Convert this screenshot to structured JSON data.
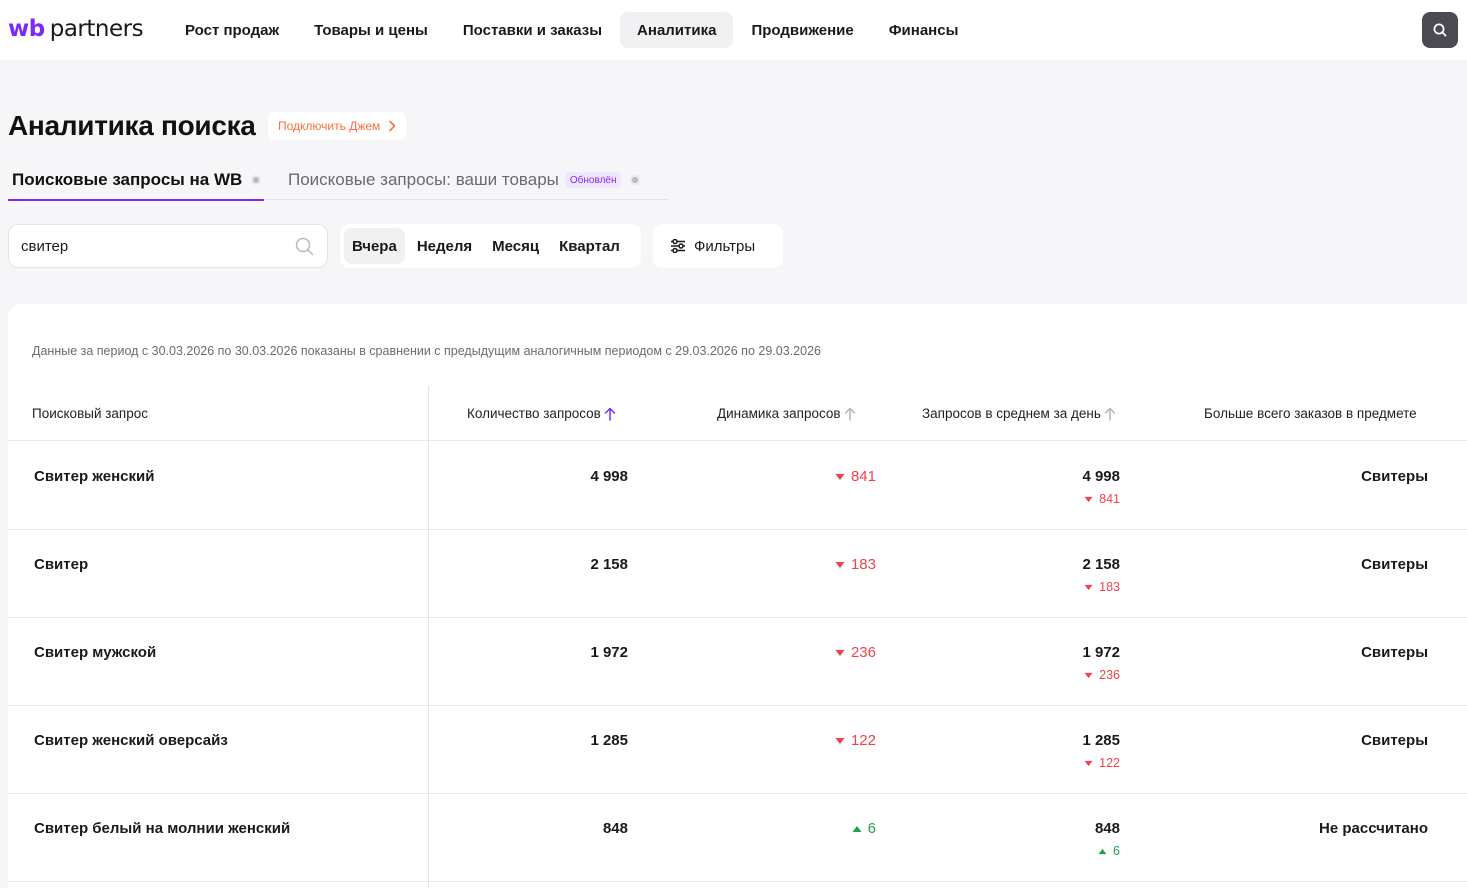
{
  "app": {
    "logo_wb": "wb",
    "logo_partners": "partners",
    "nav": [
      "Рост продаж",
      "Товары и цены",
      "Поставки и заказы",
      "Аналитика",
      "Продвижение",
      "Финансы"
    ],
    "search_icon": "search-icon"
  },
  "page": {
    "title": "Аналитика поиска",
    "promo_label": "Подключить Джем",
    "tabs": [
      {
        "label": "Поисковые запросы на WB",
        "active": true
      },
      {
        "label": "Поисковые запросы: ваши товары",
        "badge": "Обновлён",
        "active": false
      }
    ]
  },
  "controls": {
    "search_value": "свитер",
    "periods": [
      "Вчера",
      "Неделя",
      "Месяц",
      "Квартал"
    ],
    "active_period": "Вчера",
    "filters_label": "Фильтры"
  },
  "table": {
    "period_note": "Данные за период с 30.03.2026 по 30.03.2026 показаны в сравнении с предыдущим аналогичным периодом с 29.03.2026 по 29.03.2026",
    "headers": {
      "query": "Поисковый запрос",
      "count": "Количество запросов",
      "dynamics": "Динамика запросов",
      "avg": "Запросов в среднем за день",
      "subject": "Больше всего заказов в предмете"
    },
    "sorted_column": "count",
    "rows": [
      {
        "query": "Свитер женский",
        "count": "4 998",
        "dynamics": "841",
        "trend": "down",
        "avg": "4 998",
        "avg_dyn": "841",
        "subject": "Свитеры"
      },
      {
        "query": "Свитер",
        "count": "2 158",
        "dynamics": "183",
        "trend": "down",
        "avg": "2 158",
        "avg_dyn": "183",
        "subject": "Свитеры"
      },
      {
        "query": "Свитер мужской",
        "count": "1 972",
        "dynamics": "236",
        "trend": "down",
        "avg": "1 972",
        "avg_dyn": "236",
        "subject": "Свитеры"
      },
      {
        "query": "Свитер женский оверсайз",
        "count": "1 285",
        "dynamics": "122",
        "trend": "down",
        "avg": "1 285",
        "avg_dyn": "122",
        "subject": "Свитеры"
      },
      {
        "query": "Свитер белый на молнии женский",
        "count": "848",
        "dynamics": "6",
        "trend": "up",
        "avg": "848",
        "avg_dyn": "6",
        "subject": "Не рассчитано"
      }
    ]
  },
  "colors": {
    "accent": "#7b2bf9",
    "promo": "#ff6e3c",
    "negative": "#f0424b",
    "positive": "#1ea24d"
  }
}
